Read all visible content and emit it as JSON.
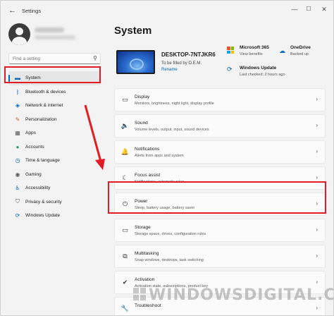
{
  "window": {
    "title": "Settings",
    "back_glyph": "←",
    "min_glyph": "—",
    "max_glyph": "☐",
    "close_glyph": "✕"
  },
  "search": {
    "placeholder": "Find a setting",
    "icon": "search-icon",
    "icon_glyph": "⚲"
  },
  "sidebar": {
    "items": [
      {
        "label": "System",
        "icon": "monitor-icon",
        "glyph": "▬",
        "color": "#0067c0"
      },
      {
        "label": "Bluetooth & devices",
        "icon": "bluetooth-icon",
        "glyph": "ᛒ",
        "color": "#0067c0"
      },
      {
        "label": "Network & internet",
        "icon": "wifi-icon",
        "glyph": "◈",
        "color": "#0067c0"
      },
      {
        "label": "Personalization",
        "icon": "brush-icon",
        "glyph": "✎",
        "color": "#c4622d"
      },
      {
        "label": "Apps",
        "icon": "apps-icon",
        "glyph": "▦",
        "color": "#5a5a5a"
      },
      {
        "label": "Accounts",
        "icon": "person-icon",
        "glyph": "●",
        "color": "#2e9e6b"
      },
      {
        "label": "Time & language",
        "icon": "globe-clock-icon",
        "glyph": "◷",
        "color": "#0067c0"
      },
      {
        "label": "Gaming",
        "icon": "gamepad-icon",
        "glyph": "◉",
        "color": "#5a5a5a"
      },
      {
        "label": "Accessibility",
        "icon": "accessibility-icon",
        "glyph": "♿",
        "color": "#0067c0"
      },
      {
        "label": "Privacy & security",
        "icon": "shield-icon",
        "glyph": "⛉",
        "color": "#5a5a5a"
      },
      {
        "label": "Windows Update",
        "icon": "update-icon",
        "glyph": "⟳",
        "color": "#0067c0"
      }
    ]
  },
  "main": {
    "title": "System",
    "device": {
      "name": "DESKTOP-7NTJKR6",
      "subtitle": "To be filled by O.E.M.",
      "rename": "Rename"
    },
    "tiles": {
      "ms365": {
        "title": "Microsoft 365",
        "sub": "View benefits"
      },
      "onedrive": {
        "title": "OneDrive",
        "sub": "Backed up",
        "glyph": "☁"
      },
      "update": {
        "title": "Windows Update",
        "sub": "Last checked: 2 hours ago",
        "glyph": "⟳"
      }
    },
    "cards": [
      {
        "title": "Display",
        "sub": "Monitors, brightness, night light, display profile",
        "icon": "display-icon",
        "glyph": "▭"
      },
      {
        "title": "Sound",
        "sub": "Volume levels, output, input, sound devices",
        "icon": "speaker-icon",
        "glyph": "🔈"
      },
      {
        "title": "Notifications",
        "sub": "Alerts from apps and system",
        "icon": "bell-icon",
        "glyph": "🔔"
      },
      {
        "title": "Focus assist",
        "sub": "Notifications, automatic rules",
        "icon": "moon-icon",
        "glyph": "☾"
      },
      {
        "title": "Power",
        "sub": "Sleep, battery usage, battery saver",
        "icon": "power-icon",
        "glyph": "⏻"
      },
      {
        "title": "Storage",
        "sub": "Storage space, drives, configuration rules",
        "icon": "storage-icon",
        "glyph": "▭"
      },
      {
        "title": "Multitasking",
        "sub": "Snap windows, desktops, task switching",
        "icon": "multitask-icon",
        "glyph": "⧉"
      },
      {
        "title": "Activation",
        "sub": "Activation state, subscriptions, product key",
        "icon": "check-circle-icon",
        "glyph": "✔"
      },
      {
        "title": "Troubleshoot",
        "sub": "",
        "icon": "wrench-icon",
        "glyph": "🔧"
      }
    ],
    "chevron": "›"
  },
  "watermark": "WINDOWSDIGITAL.COM",
  "colors": {
    "accent": "#0067c0",
    "highlight": "#e31b23"
  }
}
